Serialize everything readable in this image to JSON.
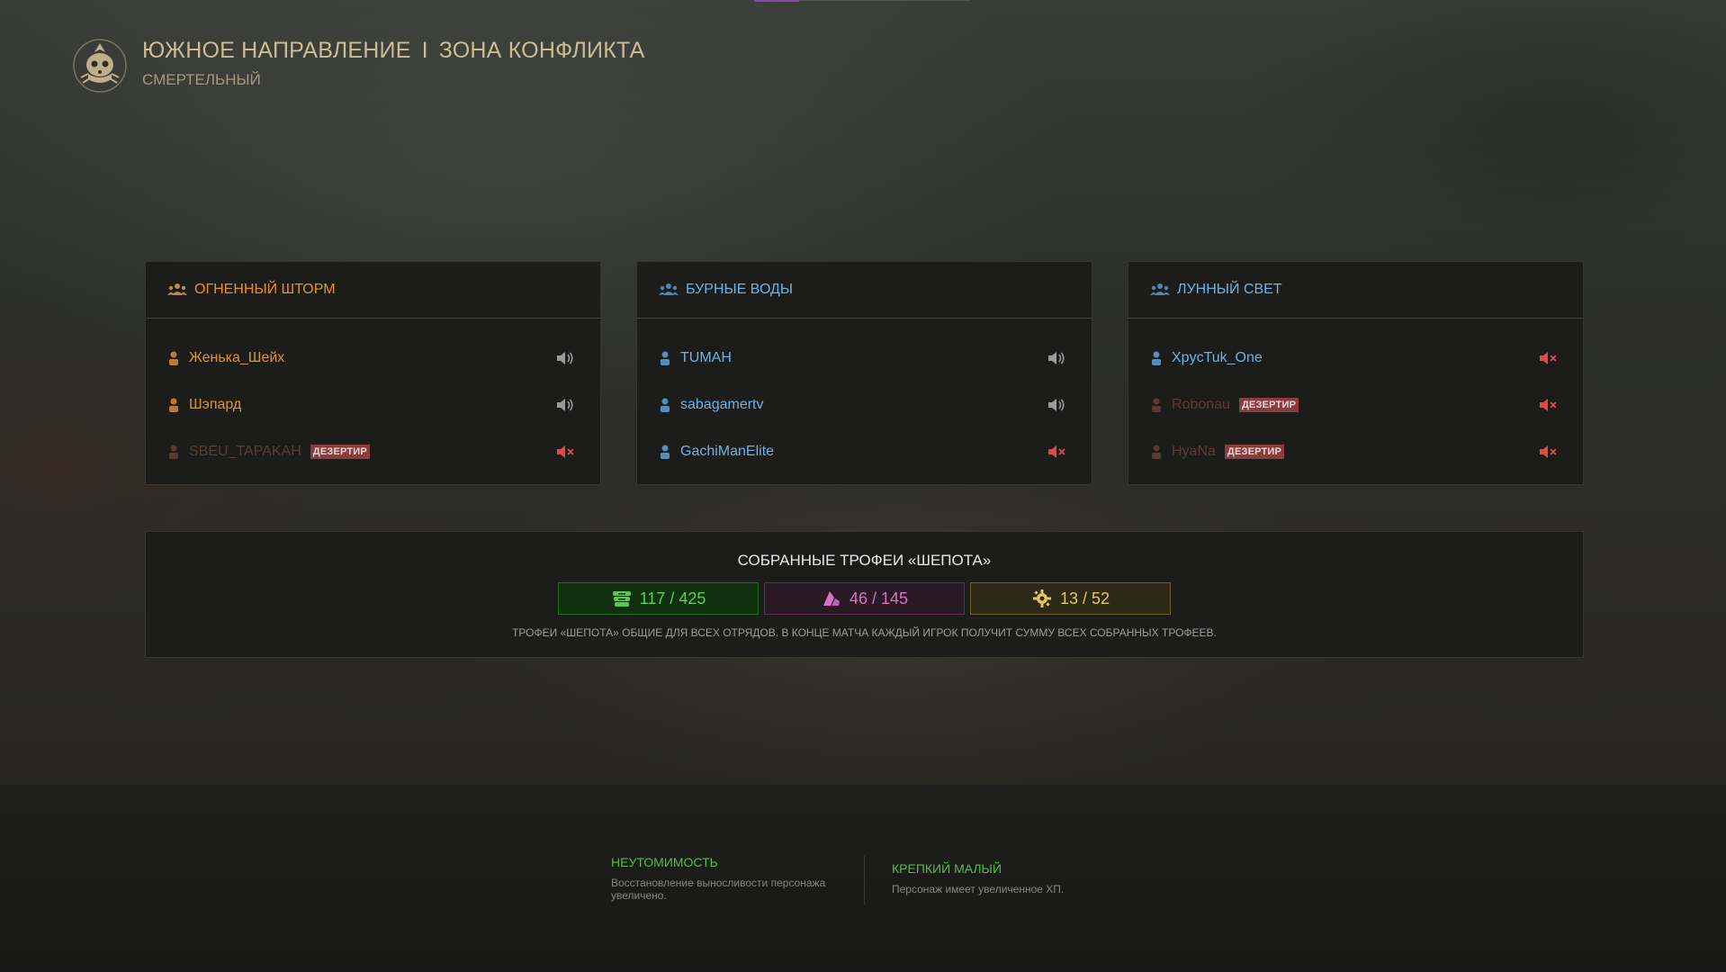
{
  "header": {
    "title_left": "ЮЖНОЕ НАПРАВЛЕНИЕ",
    "title_separator": "I",
    "title_right": "ЗОНА КОНФЛИКТА",
    "difficulty": "СМЕРТЕЛЬНЫЙ",
    "emblem_icon": "skull-emblem-icon"
  },
  "squads": [
    {
      "name": "ОГНЕННЫЙ ШТОРМ",
      "color": "#e6922f",
      "players": [
        {
          "name": "Женька_Шейх",
          "deserter": false,
          "voice": "speaker-on"
        },
        {
          "name": "Шэпард",
          "deserter": false,
          "voice": "speaker-on"
        },
        {
          "name": "SBEU_TAPAKAH",
          "deserter": true,
          "badge": "ДЕЗЕРТИР",
          "voice": "speaker-muted"
        }
      ]
    },
    {
      "name": "БУРНЫЕ ВОДЫ",
      "color": "#6fb2e6",
      "players": [
        {
          "name": "TUMAH",
          "deserter": false,
          "voice": "speaker-on"
        },
        {
          "name": "sabagamertv",
          "deserter": false,
          "voice": "speaker-on"
        },
        {
          "name": "GachiManElite",
          "deserter": false,
          "voice": "speaker-muted"
        }
      ]
    },
    {
      "name": "ЛУННЫЙ СВЕТ",
      "color": "#6fb2e6",
      "players": [
        {
          "name": "XpycTuk_One",
          "deserter": false,
          "voice": "speaker-muted"
        },
        {
          "name": "Robonau",
          "deserter": true,
          "badge": "ДЕЗЕРТИР",
          "voice": "speaker-muted"
        },
        {
          "name": "HyaNa",
          "deserter": true,
          "badge": "ДЕЗЕРТИР",
          "voice": "speaker-muted"
        }
      ]
    }
  ],
  "trophies": {
    "title": "СОБРАННЫЕ ТРОФЕИ «ШЕПОТА»",
    "counters": [
      {
        "icon": "stack-icon",
        "value": "117 / 425",
        "color": "#57d44e"
      },
      {
        "icon": "crystal-icon",
        "value": "46 / 145",
        "color": "#d672c5"
      },
      {
        "icon": "gear-icon",
        "value": "13 / 52",
        "color": "#e3c860"
      }
    ],
    "note": "ТРОФЕИ «ШЕПОТА» ОБЩИЕ ДЛЯ ВСЕХ ОТРЯДОВ. В КОНЦЕ МАТЧА КАЖДЫЙ ИГРОК ПОЛУЧИТ СУММУ ВСЕХ СОБРАННЫХ ТРОФЕЕВ."
  },
  "perks": [
    {
      "title": "НЕУТОМИМОСТЬ",
      "desc_line1": "Восстановление выносливости персонажа",
      "desc_line2": "увеличено."
    },
    {
      "title": "КРЕПКИЙ МАЛЫЙ",
      "desc_line1": "Персонаж имеет увеличенное ХП."
    }
  ]
}
